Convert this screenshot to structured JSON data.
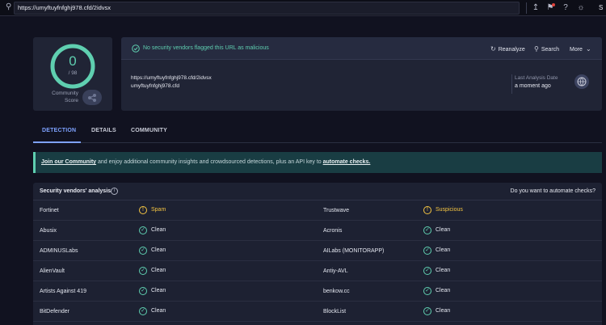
{
  "topbar": {
    "url": "https://umyftuyfnfghj978.cfd/2idvsx",
    "icons": [
      "upload-icon",
      "flag-icon",
      "help-icon",
      "theme-icon"
    ],
    "right_button": "S"
  },
  "score": {
    "value": "0",
    "total": "/ 98",
    "community_label_line1": "Community",
    "community_label_line2": "Score",
    "ring_color": "#5fcfb0"
  },
  "summary": {
    "status_message": "No security vendors flagged this URL as malicious",
    "actions": {
      "reanalyze": "Reanalyze",
      "search": "Search",
      "more": "More"
    },
    "url": "https://umyftuyfnfghj978.cfd/2idvsx",
    "host": "umyftuyfnfghj978.cfd",
    "last_analysis_label": "Last Analysis Date",
    "last_analysis_value": "a moment ago"
  },
  "tabs": [
    "DETECTION",
    "DETAILS",
    "COMMUNITY"
  ],
  "banner": {
    "link1": "Join our Community",
    "text": " and enjoy additional community insights and crowdsourced detections, plus an API key to ",
    "link2": "automate checks."
  },
  "vendors": {
    "title": "Security vendors' analysis",
    "automate_question": "Do you want to automate checks?",
    "rows": [
      {
        "left": {
          "name": "Fortinet",
          "result": "Spam",
          "status": "warn"
        },
        "right": {
          "name": "Trustwave",
          "result": "Suspicious",
          "status": "warn"
        }
      },
      {
        "left": {
          "name": "Abusix",
          "result": "Clean",
          "status": "clean"
        },
        "right": {
          "name": "Acronis",
          "result": "Clean",
          "status": "clean"
        }
      },
      {
        "left": {
          "name": "ADMINUSLabs",
          "result": "Clean",
          "status": "clean"
        },
        "right": {
          "name": "AILabs (MONITORAPP)",
          "result": "Clean",
          "status": "clean"
        }
      },
      {
        "left": {
          "name": "AlienVault",
          "result": "Clean",
          "status": "clean"
        },
        "right": {
          "name": "Antiy-AVL",
          "result": "Clean",
          "status": "clean"
        }
      },
      {
        "left": {
          "name": "Artists Against 419",
          "result": "Clean",
          "status": "clean"
        },
        "right": {
          "name": "benkow.cc",
          "result": "Clean",
          "status": "clean"
        }
      },
      {
        "left": {
          "name": "BitDefender",
          "result": "Clean",
          "status": "clean"
        },
        "right": {
          "name": "BlockList",
          "result": "Clean",
          "status": "clean"
        }
      }
    ]
  },
  "colors": {
    "accent": "#7ea2ff",
    "clean": "#5fcfb0",
    "warn": "#f5c542"
  }
}
